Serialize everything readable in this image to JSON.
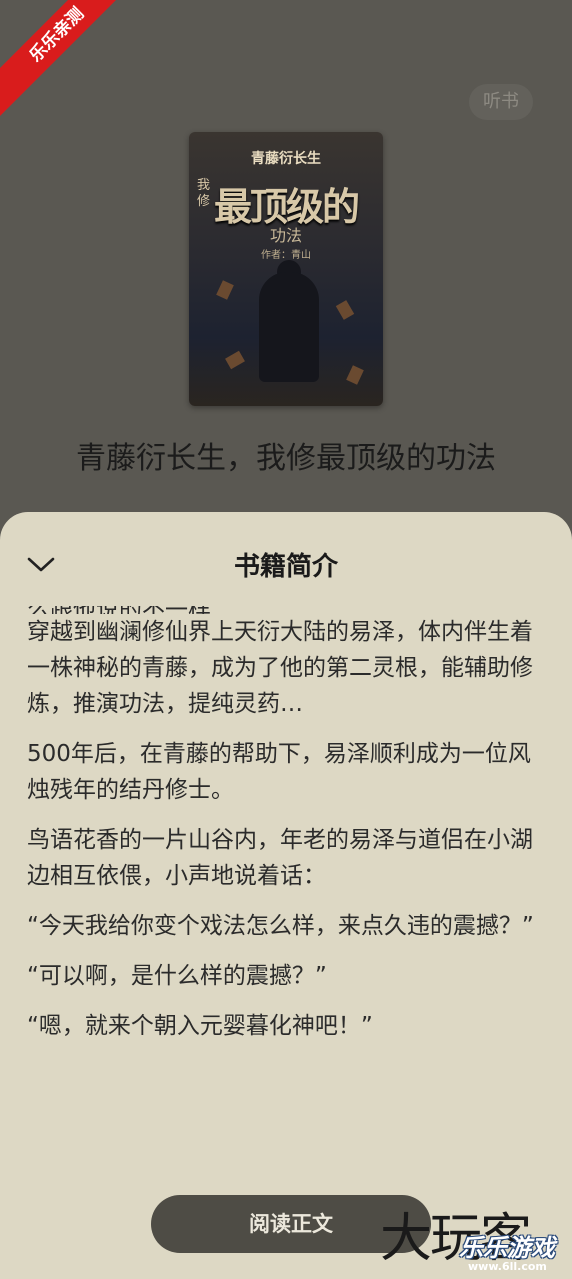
{
  "header": {
    "listen_label": "听书"
  },
  "cover": {
    "top_text": "青藤衍长生",
    "side_text": "我修",
    "main_text": "最顶级的",
    "sub_text": "功法",
    "author_text": "作者：青山"
  },
  "book": {
    "title": "青藤衍长生，我修最顶级的功法"
  },
  "sheet": {
    "title": "书籍简介",
    "partial_line": "么跟他说的不一样…",
    "paragraphs": [
      "穿越到幽澜修仙界上天衍大陆的易泽，体内伴生着一株神秘的青藤，成为了他的第二灵根，能辅助修炼，推演功法，提纯灵药…",
      "500年后，在青藤的帮助下，易泽顺利成为一位风烛残年的结丹修士。",
      "鸟语花香的一片山谷内，年老的易泽与道侣在小湖边相互依偎，小声地说着话：",
      "“今天我给你变个戏法怎么样，来点久违的震撼？”",
      "“可以啊，是什么样的震撼？”",
      "“嗯，就来个朝入元婴暮化神吧！”"
    ],
    "read_button": "阅读正文"
  },
  "watermarks": {
    "ribbon": "乐乐亲测",
    "big": "大玩客",
    "small": "乐乐游戏",
    "url": "www.6ll.com"
  },
  "colors": {
    "sheet_bg": "#ddd8c4",
    "overlay_bg": "#5a5852",
    "button_bg": "#4e4c45",
    "ribbon": "#d91c1c"
  }
}
